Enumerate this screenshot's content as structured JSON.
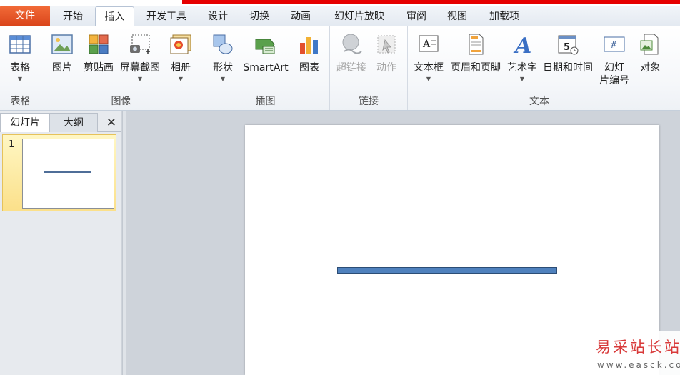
{
  "tabs": {
    "file": "文件",
    "home": "开始",
    "insert": "插入",
    "developer": "开发工具",
    "design": "设计",
    "transitions": "切换",
    "animations": "动画",
    "slideshow": "幻灯片放映",
    "review": "审阅",
    "view": "视图",
    "addins": "加载项"
  },
  "ribbon": {
    "tables": {
      "label": "表格",
      "table": "表格"
    },
    "images": {
      "label": "图像",
      "picture": "图片",
      "clipart": "剪贴画",
      "screenshot": "屏幕截图",
      "album": "相册"
    },
    "illustrations": {
      "label": "插图",
      "shapes": "形状",
      "smartart": "SmartArt",
      "chart": "图表"
    },
    "links": {
      "label": "链接",
      "hyperlink": "超链接",
      "action": "动作"
    },
    "text": {
      "label": "文本",
      "textbox": "文本框",
      "headerfooter": "页眉和页脚",
      "wordart": "艺术字",
      "datetime": "日期和时间",
      "slidenum_1": "幻灯",
      "slidenum_2": "片编号",
      "object": "对象"
    }
  },
  "panel": {
    "tab_slides": "幻灯片",
    "tab_outline": "大纲",
    "close": "✕",
    "slide_number": "1"
  },
  "watermark": {
    "title": "易采站长站",
    "url": "www.easck.com"
  },
  "colors": {
    "file_tab": "#e05a2a",
    "shape_fill": "#4f81bd",
    "accent_red": "#e60000"
  }
}
